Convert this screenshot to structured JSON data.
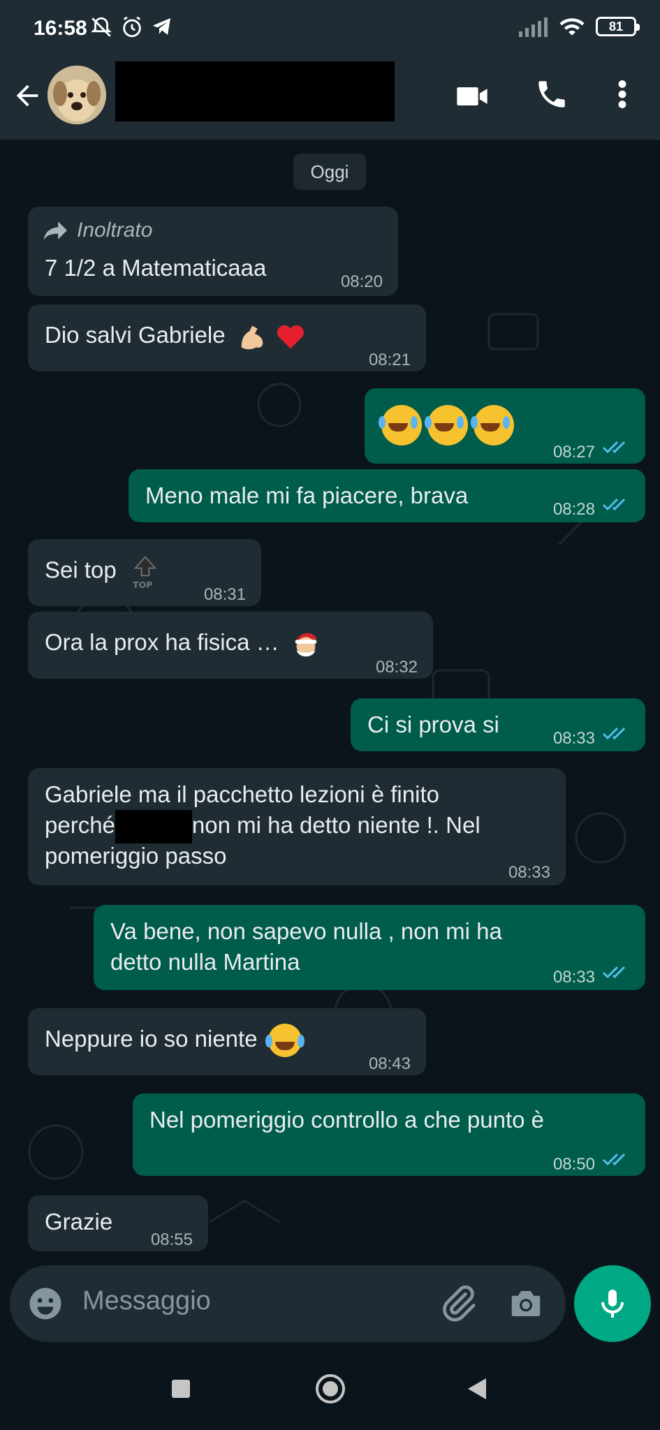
{
  "status_bar": {
    "time": "16:58",
    "battery": "81"
  },
  "contact": {
    "name": ""
  },
  "date_separator": "Oggi",
  "forwarded_label": "Inoltrato",
  "messages": [
    {
      "dir": "in",
      "text": "7 1/2 a Matematicaaa",
      "time": "08:20"
    },
    {
      "dir": "in",
      "text": "Dio salvi Gabriele",
      "time": "08:21"
    },
    {
      "dir": "out",
      "text": "",
      "time": "08:27"
    },
    {
      "dir": "out",
      "text": "Meno male mi fa piacere, brava",
      "time": "08:28"
    },
    {
      "dir": "in",
      "text": "Sei top",
      "time": "08:31"
    },
    {
      "dir": "in",
      "text": "Ora la prox ha fisica …",
      "time": "08:32"
    },
    {
      "dir": "out",
      "text": "Ci si prova si",
      "time": "08:33"
    },
    {
      "dir": "in",
      "line1": "Gabriele ma il pacchetto  lezioni è finito",
      "line2a": "perché",
      "line2b": "non mi ha detto niente !. Nel",
      "line3": "pomeriggio passo",
      "time": "08:33"
    },
    {
      "dir": "out",
      "line1": "Va bene, non sapevo nulla , non mi ha",
      "line2": "detto nulla Martina",
      "time": "08:33"
    },
    {
      "dir": "in",
      "text": "Neppure io so niente",
      "time": "08:43"
    },
    {
      "dir": "out",
      "text": "Nel pomeriggio controllo a che punto è",
      "time": "08:50"
    },
    {
      "dir": "in",
      "text": "Grazie",
      "time": "08:55"
    }
  ],
  "composer": {
    "placeholder": "Messaggio"
  },
  "colors": {
    "incoming": "#202c33",
    "outgoing": "#005c4b",
    "accent": "#00a884",
    "read_ticks": "#53bdeb"
  }
}
